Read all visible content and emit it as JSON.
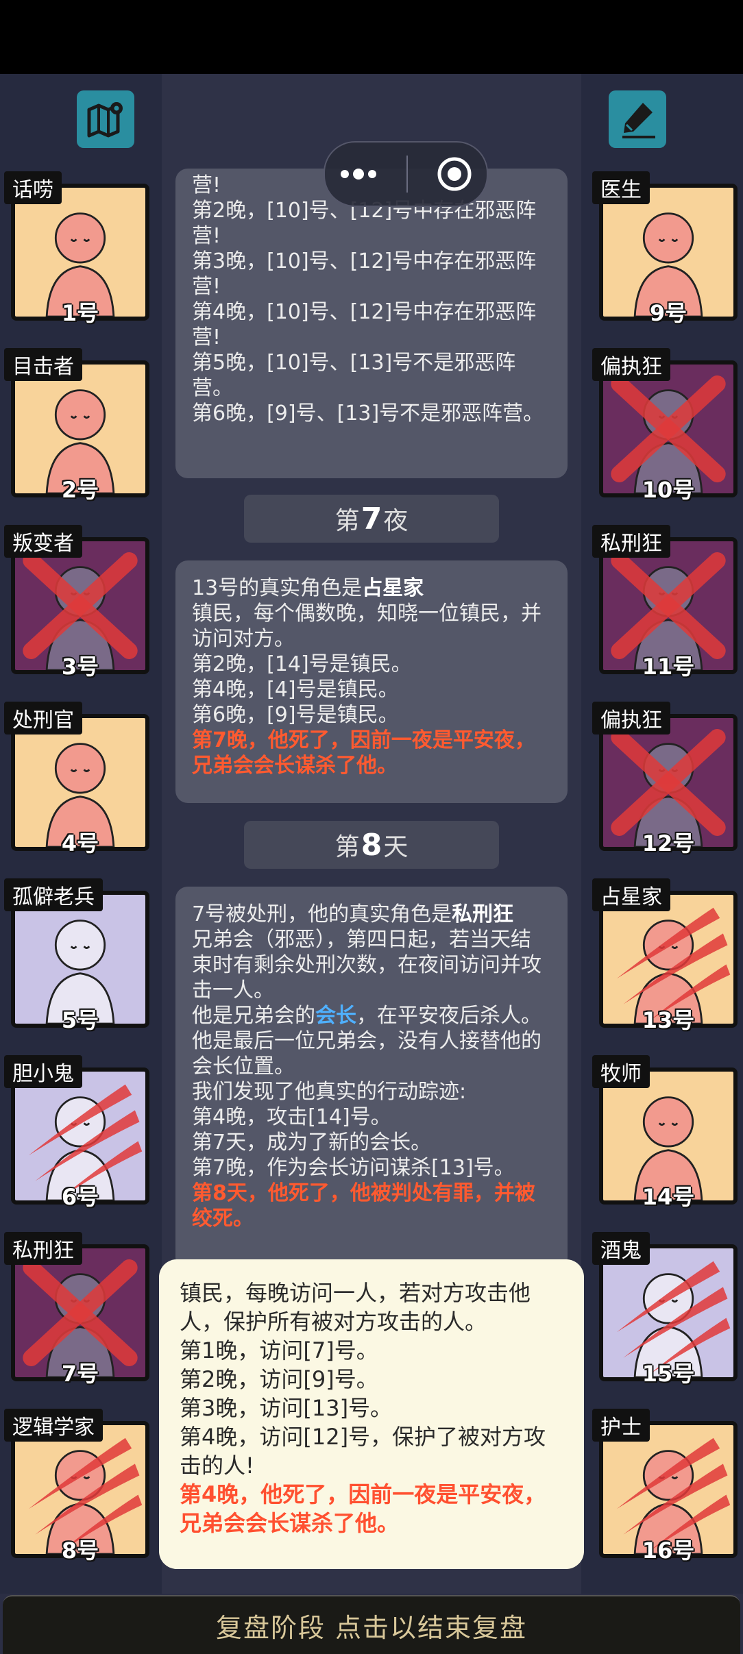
{
  "panel_top": {
    "lines": [
      "营!",
      "第2晚，[10]号、[12]号中存在邪恶阵营!",
      "第3晚，[10]号、[12]号中存在邪恶阵营!",
      "第4晚，[10]号、[12]号中存在邪恶阵营!",
      "第5晚，[10]号、[13]号不是邪恶阵营。",
      "第6晚，[9]号、[13]号不是邪恶阵营。"
    ]
  },
  "header1": {
    "prefix": "第",
    "number": "7",
    "suffix": "夜"
  },
  "panel_mid": {
    "intro": "13号的真实角色是",
    "role": "占星家",
    "lines": [
      "镇民，每个偶数晚，知晓一位镇民，并访问对方。",
      "第2晚，[14]号是镇民。",
      "第4晚，[4]号是镇民。",
      "第6晚，[9]号是镇民。"
    ],
    "death": "第7晚，他死了，因前一夜是平安夜，兄弟会会长谋杀了他。"
  },
  "header2": {
    "prefix": "第",
    "number": "8",
    "suffix": "天"
  },
  "panel_bottom": {
    "intro": "7号被处刑，他的真实角色是",
    "role": "私刑狂",
    "line1": "兄弟会（邪恶），第四日起，若当天结束时有剩余处刑次数，在夜间访问并攻击一人。",
    "line2a": "他是兄弟会的",
    "line2b": "会长",
    "line2c": "，在平安夜后杀人。他是最后一位兄弟会，没有人接替他的会长位置。",
    "lines": [
      "我们发现了他真实的行动踪迹:",
      "第4晚，攻击[14]号。",
      "第7天，成为了新的会长。",
      "第7晚，作为会长访问谋杀[13]号。"
    ],
    "death": "第8天，他死了，他被判处有罪，并被绞死。"
  },
  "popup": {
    "lines": [
      "镇民，每晚访问一人，若对方攻击他人，保护所有被对方攻击的人。",
      "第1晚，访问[7]号。",
      "第2晚，访问[9]号。",
      "第3晚，访问[13]号。",
      "第4晚，访问[12]号，保护了被对方攻击的人!"
    ],
    "death": "第4晚，他死了，因前一夜是平安夜，兄弟会会长谋杀了他。"
  },
  "bottom_bar": "复盘阶段 点击以结束复盘",
  "icons": {
    "left": "map-icon",
    "right": "edit-icon",
    "capsule_more": "more-icon",
    "capsule_close": "record-icon"
  },
  "colors": {
    "dead_mark": "#e03a3a",
    "highlight_red": "#ff5a30",
    "highlight_blue": "#4fb0ff"
  },
  "players_left": [
    {
      "role": "话唠",
      "num": "1号",
      "bg": "yellow",
      "mark": "none"
    },
    {
      "role": "目击者",
      "num": "2号",
      "bg": "yellow",
      "mark": "none"
    },
    {
      "role": "叛变者",
      "num": "3号",
      "bg": "purple",
      "mark": "x"
    },
    {
      "role": "处刑官",
      "num": "4号",
      "bg": "yellow",
      "mark": "none"
    },
    {
      "role": "孤僻老兵",
      "num": "5号",
      "bg": "lav",
      "mark": "none"
    },
    {
      "role": "胆小鬼",
      "num": "6号",
      "bg": "lav",
      "mark": "claw"
    },
    {
      "role": "私刑狂",
      "num": "7号",
      "bg": "purple",
      "mark": "x"
    },
    {
      "role": "逻辑学家",
      "num": "8号",
      "bg": "yellow",
      "mark": "claw"
    }
  ],
  "players_right": [
    {
      "role": "医生",
      "num": "9号",
      "bg": "yellow",
      "mark": "none"
    },
    {
      "role": "偏执狂",
      "num": "10号",
      "bg": "purple",
      "mark": "x"
    },
    {
      "role": "私刑狂",
      "num": "11号",
      "bg": "purple",
      "mark": "x"
    },
    {
      "role": "偏执狂",
      "num": "12号",
      "bg": "purple",
      "mark": "x"
    },
    {
      "role": "占星家",
      "num": "13号",
      "bg": "yellow",
      "mark": "claw"
    },
    {
      "role": "牧师",
      "num": "14号",
      "bg": "yellow",
      "mark": "none"
    },
    {
      "role": "酒鬼",
      "num": "15号",
      "bg": "lav",
      "mark": "claw"
    },
    {
      "role": "护士",
      "num": "16号",
      "bg": "yellow",
      "mark": "claw"
    }
  ]
}
